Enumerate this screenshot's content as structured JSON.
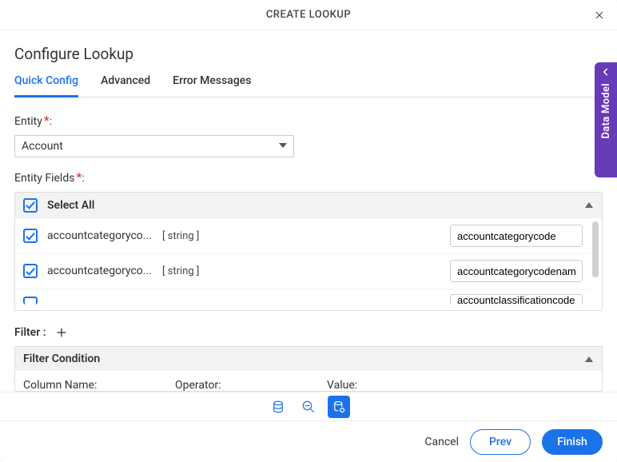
{
  "modal": {
    "title": "CREATE LOOKUP"
  },
  "page": {
    "title": "Configure Lookup"
  },
  "tabs": [
    {
      "label": "Quick Config",
      "active": true
    },
    {
      "label": "Advanced",
      "active": false
    },
    {
      "label": "Error Messages",
      "active": false
    }
  ],
  "entity": {
    "label": "Entity",
    "value": "Account"
  },
  "entity_fields": {
    "label": "Entity Fields",
    "select_all_label": "Select All",
    "rows": [
      {
        "name": "accountcategoryco...",
        "type": "[ string ]",
        "value": "accountcategorycode"
      },
      {
        "name": "accountcategoryco...",
        "type": "[ string ]",
        "value": "accountcategorycodename"
      }
    ],
    "partial_value": "accountclassificationcode"
  },
  "filter": {
    "label": "Filter :",
    "panel_title": "Filter Condition",
    "columns": {
      "c1": "Column Name:",
      "c2": "Operator:",
      "c3": "Value:"
    }
  },
  "footer": {
    "cancel": "Cancel",
    "prev": "Prev",
    "finish": "Finish"
  },
  "side": {
    "label": "Data Model"
  }
}
